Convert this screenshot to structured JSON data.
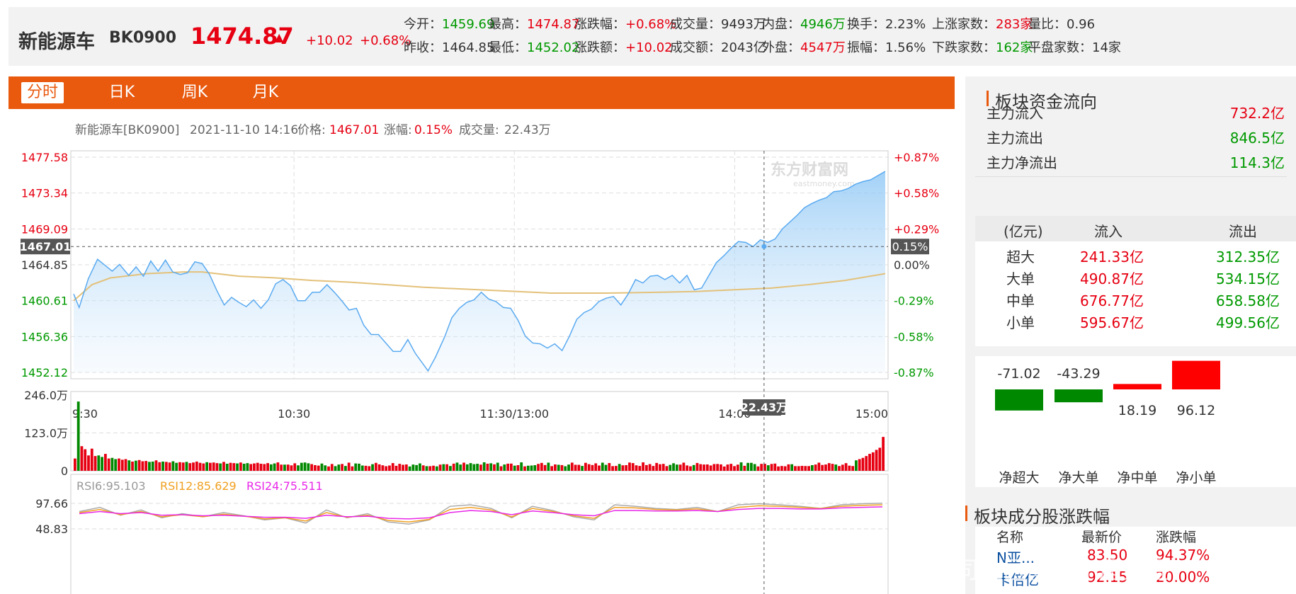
{
  "header": {
    "name": "新能源车",
    "code": "BK0900",
    "price": "1474.87",
    "arrow": "▲",
    "change": "+10.02",
    "change_pct": "+0.68%",
    "quotes_row1": [
      {
        "label": "今开：",
        "value": "1459.69",
        "color": "green"
      },
      {
        "label": "最高：",
        "value": "1474.87",
        "color": "red"
      },
      {
        "label": "涨跌幅：",
        "value": "+0.68%",
        "color": "red"
      },
      {
        "label": "成交量：",
        "value": "9493万",
        "color": ""
      },
      {
        "label": "内盘：",
        "value": "4946万",
        "color": "green"
      },
      {
        "label": "换手：",
        "value": "2.23%",
        "color": ""
      },
      {
        "label": "上涨家数：",
        "value": "283家",
        "color": "red"
      },
      {
        "label": "量比：",
        "value": "0.96",
        "color": ""
      }
    ],
    "quotes_row2": [
      {
        "label": "昨收：",
        "value": "1464.85",
        "color": ""
      },
      {
        "label": "最低：",
        "value": "1452.02",
        "color": "green"
      },
      {
        "label": "涨跌额：",
        "value": "+10.02",
        "color": "red"
      },
      {
        "label": "成交额：",
        "value": "2043亿",
        "color": ""
      },
      {
        "label": "外盘：",
        "value": "4547万",
        "color": "red"
      },
      {
        "label": "振幅：",
        "value": "1.56%",
        "color": ""
      },
      {
        "label": "下跌家数：",
        "value": "162家",
        "color": "green"
      },
      {
        "label": "平盘家数：",
        "value": "14家",
        "color": ""
      }
    ]
  },
  "tabs": [
    {
      "label": "分时"
    },
    {
      "label": "日K"
    },
    {
      "label": "周K"
    },
    {
      "label": "月K"
    }
  ],
  "chart_data": [
    {
      "type": "line",
      "info": {
        "name": "新能源车[BK0900]",
        "datetime": "2021-11-10 14:16",
        "price_label": "价格:",
        "price": "1467.01",
        "chg_label": "涨幅:",
        "chg": "0.15%",
        "vol_label": "成交量:",
        "vol": "22.43万"
      },
      "ylim": [
        1452.12,
        1477.58
      ],
      "yticks_left": [
        "1477.58",
        "1473.34",
        "1469.09",
        "1464.85",
        "1460.61",
        "1456.36",
        "1452.12"
      ],
      "yticks_right": [
        "+0.87%",
        "+0.58%",
        "+0.29%",
        "0.00%",
        "-0.29%",
        "-0.58%",
        "-0.87%"
      ],
      "prev_close": 1464.85,
      "xticks": [
        "9:30",
        "10:30",
        "11:30/13:00",
        "14:00",
        "15:00"
      ],
      "crosshair": {
        "time": "14:16",
        "price": "1467.01",
        "pct": "0.15%"
      },
      "watermark": "东方财富网",
      "watermark_sub": "eastmoney.com",
      "price_series": [
        [
          0,
          1461.4
        ],
        [
          3,
          1459.8
        ],
        [
          8,
          1463.2
        ],
        [
          13,
          1465.5
        ],
        [
          17,
          1464.8
        ],
        [
          21,
          1464.1
        ],
        [
          25,
          1464.9
        ],
        [
          30,
          1463.6
        ],
        [
          34,
          1464.6
        ],
        [
          38,
          1463.5
        ],
        [
          42,
          1465.3
        ],
        [
          46,
          1464.1
        ],
        [
          50,
          1465.4
        ],
        [
          54,
          1464.0
        ],
        [
          58,
          1463.7
        ],
        [
          62,
          1463.9
        ],
        [
          66,
          1465.2
        ],
        [
          70,
          1465.0
        ],
        [
          74,
          1463.7
        ],
        [
          78,
          1461.8
        ],
        [
          82,
          1460.1
        ],
        [
          86,
          1461.0
        ],
        [
          90,
          1460.4
        ],
        [
          94,
          1459.9
        ],
        [
          98,
          1460.7
        ],
        [
          102,
          1459.7
        ],
        [
          106,
          1460.7
        ],
        [
          110,
          1462.6
        ],
        [
          114,
          1463.1
        ],
        [
          118,
          1462.4
        ],
        [
          122,
          1460.6
        ],
        [
          126,
          1460.6
        ],
        [
          130,
          1461.6
        ],
        [
          134,
          1461.6
        ],
        [
          138,
          1462.5
        ],
        [
          142,
          1461.6
        ],
        [
          146,
          1460.6
        ],
        [
          150,
          1459.5
        ],
        [
          154,
          1459.7
        ],
        [
          158,
          1457.7
        ],
        [
          162,
          1456.6
        ],
        [
          166,
          1456.6
        ],
        [
          170,
          1455.6
        ],
        [
          174,
          1454.6
        ],
        [
          178,
          1454.6
        ],
        [
          182,
          1456.0
        ],
        [
          186,
          1454.4
        ],
        [
          190,
          1453.2
        ],
        [
          193,
          1452.3
        ],
        [
          197,
          1453.9
        ],
        [
          202,
          1456.3
        ],
        [
          206,
          1458.6
        ],
        [
          210,
          1459.7
        ],
        [
          214,
          1460.4
        ],
        [
          218,
          1460.7
        ],
        [
          222,
          1461.6
        ],
        [
          226,
          1460.8
        ],
        [
          230,
          1460.5
        ],
        [
          234,
          1459.8
        ],
        [
          238,
          1459.7
        ],
        [
          242,
          1458.3
        ],
        [
          246,
          1456.4
        ],
        [
          250,
          1455.6
        ],
        [
          254,
          1455.5
        ],
        [
          258,
          1455.0
        ],
        [
          262,
          1455.5
        ],
        [
          266,
          1454.7
        ],
        [
          270,
          1456.4
        ],
        [
          274,
          1458.4
        ],
        [
          278,
          1459.2
        ],
        [
          282,
          1459.6
        ],
        [
          286,
          1460.5
        ],
        [
          290,
          1460.9
        ],
        [
          294,
          1461.1
        ],
        [
          298,
          1460.1
        ],
        [
          302,
          1461.4
        ],
        [
          306,
          1463.1
        ],
        [
          310,
          1462.7
        ],
        [
          314,
          1463.5
        ],
        [
          318,
          1463.6
        ],
        [
          322,
          1463.1
        ],
        [
          326,
          1463.6
        ],
        [
          330,
          1462.7
        ],
        [
          334,
          1463.6
        ],
        [
          338,
          1461.9
        ],
        [
          342,
          1462.1
        ],
        [
          346,
          1463.6
        ],
        [
          350,
          1465.1
        ],
        [
          354,
          1465.9
        ],
        [
          358,
          1466.8
        ],
        [
          362,
          1467.6
        ],
        [
          366,
          1467.5
        ],
        [
          370,
          1467.0
        ],
        [
          374,
          1467.8
        ],
        [
          378,
          1467.5
        ],
        [
          382,
          1467.9
        ],
        [
          386,
          1469.1
        ],
        [
          390,
          1469.9
        ],
        [
          394,
          1470.7
        ],
        [
          398,
          1471.6
        ],
        [
          402,
          1472.1
        ],
        [
          406,
          1472.5
        ],
        [
          410,
          1472.8
        ],
        [
          414,
          1473.5
        ],
        [
          418,
          1473.6
        ],
        [
          422,
          1473.9
        ],
        [
          426,
          1474.4
        ],
        [
          430,
          1474.7
        ],
        [
          434,
          1474.9
        ],
        [
          438,
          1475.4
        ],
        [
          442,
          1475.9
        ]
      ],
      "avg_series": [
        [
          0,
          1460.6
        ],
        [
          10,
          1462.5
        ],
        [
          20,
          1463.3
        ],
        [
          40,
          1463.8
        ],
        [
          60,
          1464.0
        ],
        [
          70,
          1464.0
        ],
        [
          90,
          1463.5
        ],
        [
          110,
          1463.3
        ],
        [
          130,
          1463.0
        ],
        [
          150,
          1462.8
        ],
        [
          170,
          1462.5
        ],
        [
          190,
          1462.2
        ],
        [
          210,
          1462.0
        ],
        [
          230,
          1461.8
        ],
        [
          260,
          1461.5
        ],
        [
          290,
          1461.5
        ],
        [
          320,
          1461.6
        ],
        [
          340,
          1461.7
        ],
        [
          360,
          1461.9
        ],
        [
          380,
          1462.1
        ],
        [
          400,
          1462.5
        ],
        [
          420,
          1463.0
        ],
        [
          442,
          1463.8
        ]
      ]
    },
    {
      "type": "bar",
      "ylim": [
        0,
        246
      ],
      "yticks": [
        "246.0万",
        "123.0万",
        "0"
      ],
      "crosshair_label": "22.43万",
      "volumes_early": [
        40,
        225,
        80,
        70,
        50,
        72,
        48,
        50,
        45,
        55,
        40,
        42,
        38,
        40,
        36,
        38,
        34,
        30,
        33,
        35,
        31,
        32,
        29,
        30,
        34,
        28,
        30,
        29,
        27,
        31,
        26,
        28,
        27,
        29,
        25,
        27,
        30,
        26,
        24,
        28,
        26,
        27,
        25,
        24,
        29,
        23,
        26,
        25,
        24,
        27,
        23,
        25,
        22,
        24,
        26,
        23,
        22,
        25,
        21,
        24
      ],
      "volumes_late": [
        34,
        38,
        42,
        48,
        55,
        60,
        68,
        75,
        110
      ]
    },
    {
      "type": "line",
      "title": "RSI",
      "legend": [
        {
          "name": "RSI6:95.103",
          "color": "#999999"
        },
        {
          "name": "RSI12:85.629",
          "color": "#f0a020"
        },
        {
          "name": "RSI24:75.511",
          "color": "#e828e8"
        }
      ],
      "yticks": [
        "97.66",
        "48.83"
      ],
      "ylim": [
        40,
        100
      ],
      "series": [
        {
          "name": "RSI6",
          "values": [
            82,
            90,
            75,
            85,
            70,
            78,
            72,
            80,
            74,
            66,
            70,
            60,
            85,
            70,
            78,
            62,
            58,
            66,
            92,
            95,
            88,
            70,
            92,
            84,
            72,
            66,
            95,
            92,
            88,
            86,
            90,
            82,
            95,
            97,
            95,
            92,
            88,
            95,
            97,
            98
          ]
        },
        {
          "name": "RSI12",
          "values": [
            80,
            86,
            76,
            82,
            72,
            76,
            72,
            77,
            73,
            68,
            70,
            64,
            80,
            71,
            75,
            65,
            62,
            67,
            86,
            90,
            85,
            72,
            88,
            82,
            74,
            69,
            90,
            89,
            86,
            85,
            87,
            82,
            90,
            93,
            92,
            90,
            88,
            92,
            94,
            95
          ]
        },
        {
          "name": "RSI24",
          "values": [
            78,
            82,
            78,
            80,
            75,
            76,
            74,
            75,
            73,
            71,
            71,
            69,
            75,
            72,
            73,
            69,
            68,
            70,
            80,
            84,
            82,
            76,
            83,
            80,
            76,
            74,
            84,
            84,
            83,
            83,
            84,
            82,
            86,
            88,
            88,
            87,
            87,
            89,
            90,
            91
          ]
        }
      ]
    }
  ],
  "side": {
    "flow_title": "板块资金流向",
    "flows": [
      {
        "label": "主力流入",
        "value": "732.2亿",
        "color": "red"
      },
      {
        "label": "主力流出",
        "value": "846.5亿",
        "color": "green"
      },
      {
        "label": "主力净流出",
        "value": "114.3亿",
        "color": "green"
      }
    ],
    "table_header": [
      "(亿元)",
      "流入",
      "流出"
    ],
    "table_rows": [
      [
        "超大",
        "241.33亿",
        "312.35亿"
      ],
      [
        "大单",
        "490.87亿",
        "534.15亿"
      ],
      [
        "中单",
        "676.77亿",
        "658.58亿"
      ],
      [
        "小单",
        "595.67亿",
        "499.56亿"
      ]
    ],
    "net_chart": {
      "type": "bar",
      "categories": [
        "净超大",
        "净大单",
        "净中单",
        "净小单"
      ],
      "values": [
        -71.02,
        -43.29,
        18.19,
        96.12
      ],
      "labels": [
        "-71.02",
        "-43.29",
        "18.19",
        "96.12"
      ]
    },
    "stocks_title": "板块成分股涨跌幅",
    "stocks_header": [
      "名称",
      "最新价",
      "涨跌幅"
    ],
    "stocks": [
      [
        "N亚...",
        "83.50",
        "94.37%"
      ],
      [
        "卡倍亿",
        "92.15",
        "20.00%"
      ]
    ]
  },
  "watermark": "司社区@GPP屋财经"
}
